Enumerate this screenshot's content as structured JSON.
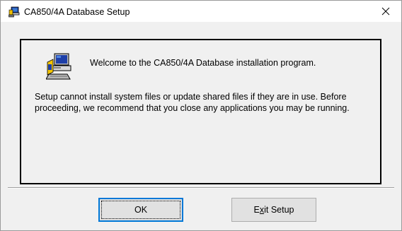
{
  "window": {
    "title": "CA850/4A Database Setup",
    "app_icon": "setup-computer-icon",
    "close_icon": "close-icon"
  },
  "panel": {
    "icon": "setup-computer-icon",
    "welcome": "Welcome to the CA850/4A Database installation program.",
    "message": "Setup cannot install system files or update shared files if they are in use. Before proceeding, we recommend that you close any applications you may be running."
  },
  "buttons": {
    "ok_label": "OK",
    "exit_label_before": "E",
    "exit_label_accel": "x",
    "exit_label_after": "it Setup"
  },
  "colors": {
    "window_bg": "#f0f0f0",
    "titlebar_bg": "#ffffff",
    "default_button_border": "#0078d7"
  }
}
